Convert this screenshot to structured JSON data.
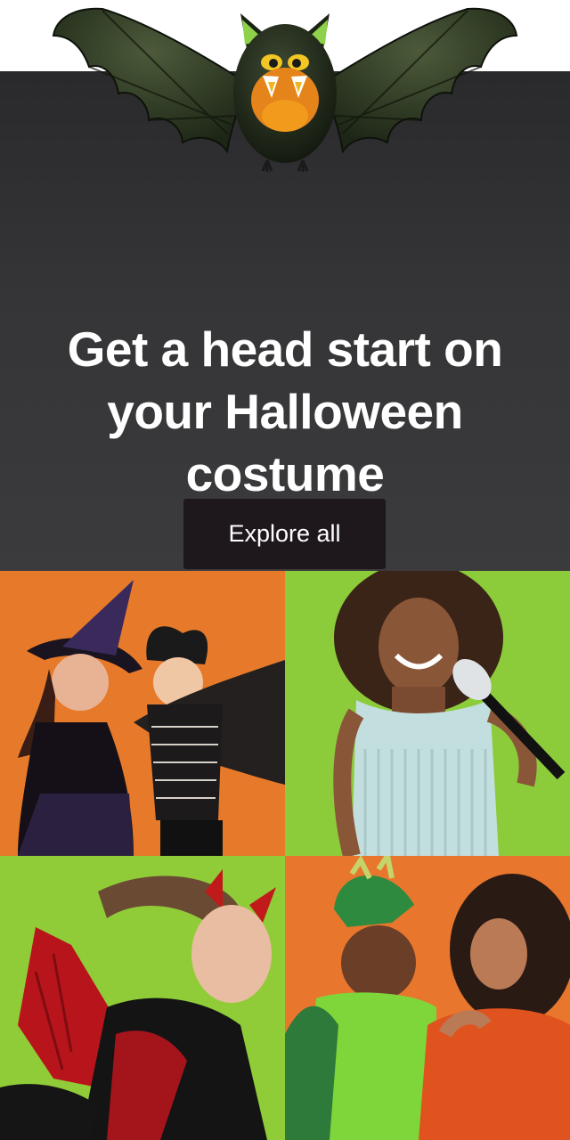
{
  "hero": {
    "headline": {
      "line1": "Get a head start on",
      "line2_prefix": "your ",
      "line2_bold": "Halloween",
      "line3_bold": "costume"
    },
    "cta_label": "Explore all",
    "decoration": "bat-icon"
  },
  "tiles": [
    {
      "name": "witch-and-bat-kids-costume-photo",
      "bg": "#e77a2a"
    },
    {
      "name": "pop-star-girl-costume-photo",
      "bg": "#8ccc3a"
    },
    {
      "name": "devil-wings-costume-photo",
      "bg": "#8fcc38"
    },
    {
      "name": "dragon-kid-and-mom-costume-photo",
      "bg": "#e8762d"
    }
  ],
  "colors": {
    "hero_bg": "#353537",
    "cta_bg": "#1e171c",
    "text": "#ffffff"
  }
}
